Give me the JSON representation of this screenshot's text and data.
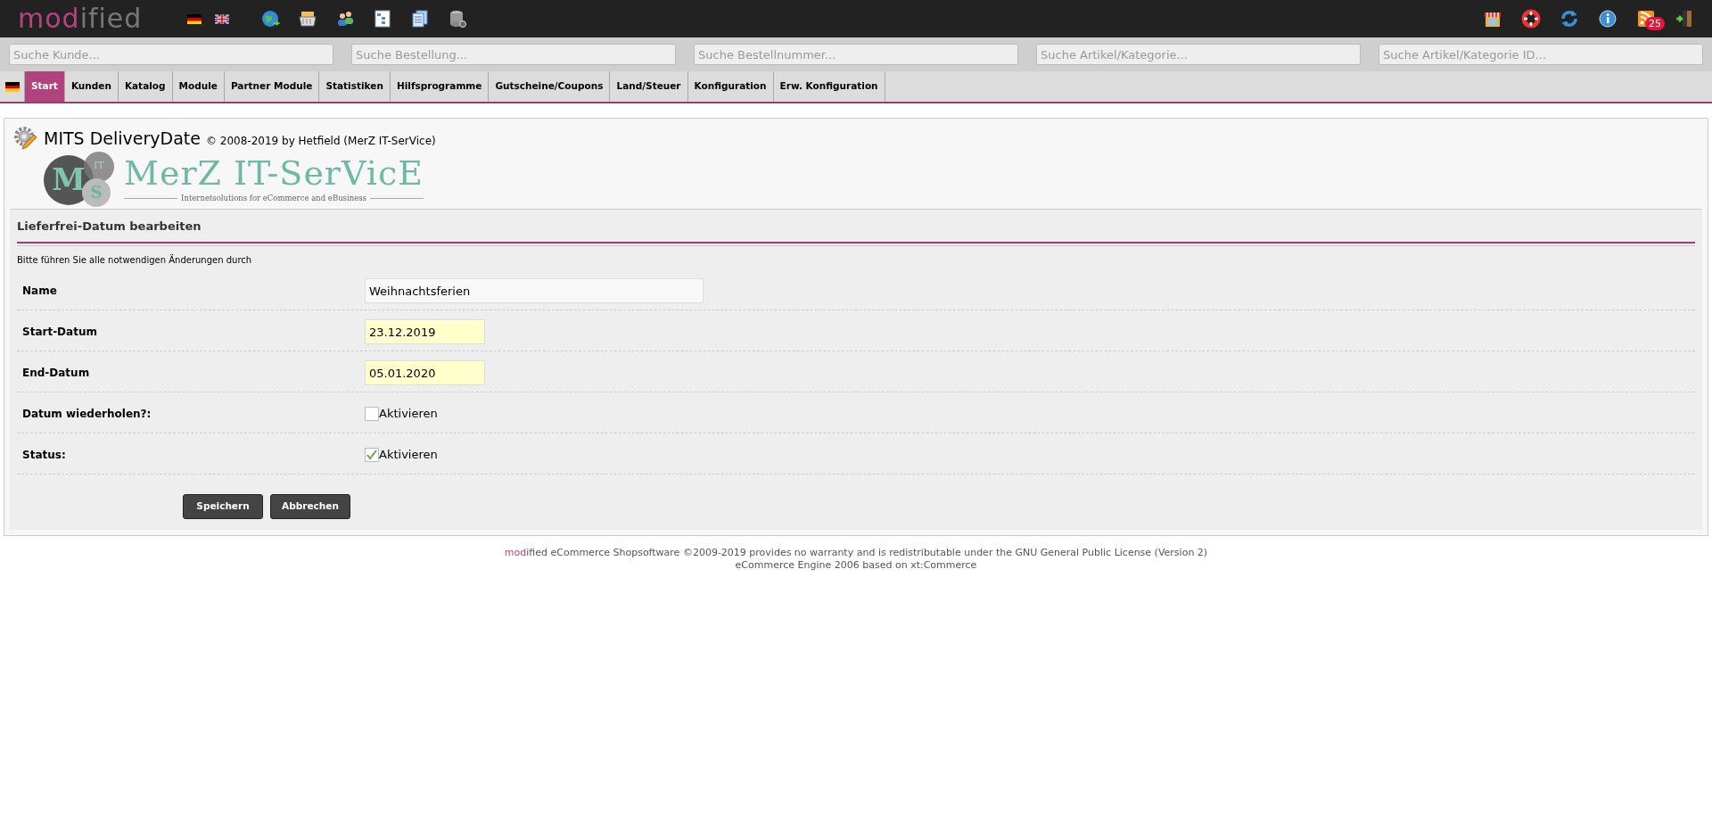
{
  "logo": {
    "accent": "mod",
    "rest": "ified"
  },
  "languages": [
    {
      "kind": "de"
    },
    {
      "kind": "en"
    }
  ],
  "toolbar_left": [
    {
      "kind": "globe"
    },
    {
      "kind": "basket"
    },
    {
      "kind": "users"
    },
    {
      "kind": "tree"
    },
    {
      "kind": "docs"
    },
    {
      "kind": "database"
    }
  ],
  "toolbar_right": [
    {
      "kind": "shop"
    },
    {
      "kind": "help"
    },
    {
      "kind": "refresh"
    },
    {
      "kind": "info"
    },
    {
      "kind": "rss",
      "badge": "25"
    },
    {
      "kind": "exit"
    }
  ],
  "searches": [
    {
      "placeholder": "Suche Kunde..."
    },
    {
      "placeholder": "Suche Bestellung..."
    },
    {
      "placeholder": "Suche Bestellnummer..."
    },
    {
      "placeholder": "Suche Artikel/Kategorie..."
    },
    {
      "placeholder": "Suche Artikel/Kategorie ID..."
    }
  ],
  "nav": [
    {
      "label": "Start",
      "selected": true
    },
    {
      "label": "Kunden",
      "selected": false
    },
    {
      "label": "Katalog",
      "selected": false
    },
    {
      "label": "Module",
      "selected": false
    },
    {
      "label": "Partner Module",
      "selected": false
    },
    {
      "label": "Statistiken",
      "selected": false
    },
    {
      "label": "Hilfsprogramme",
      "selected": false
    },
    {
      "label": "Gutscheine/Coupons",
      "selected": false
    },
    {
      "label": "Land/Steuer",
      "selected": false
    },
    {
      "label": "Konfiguration",
      "selected": false
    },
    {
      "label": "Erw. Konfiguration",
      "selected": false
    }
  ],
  "module": {
    "title": "MITS DeliveryDate",
    "copyright": "© 2008-2019 by Hetfield (MerZ IT-SerVice)",
    "banner": {
      "m": "M",
      "it": "IT",
      "s": "S",
      "name": "MerZ IT-SerVicE",
      "tagline": "Internetsolutions for eCommerce and eBusiness"
    }
  },
  "section_title": "Lieferfrei-Datum bearbeiten",
  "hint": "Bitte führen Sie alle notwendigen Änderungen durch",
  "fields": [
    {
      "kind": "text",
      "label": "Name",
      "value": "Weihnachtsferien"
    },
    {
      "kind": "date",
      "label": "Start-Datum",
      "value": "23.12.2019"
    },
    {
      "kind": "date",
      "label": "End-Datum",
      "value": "05.01.2020"
    },
    {
      "kind": "checkbox",
      "label": "Datum wiederholen?:",
      "option": "Aktivieren",
      "checked": false
    },
    {
      "kind": "checkbox",
      "label": "Status:",
      "option": "Aktivieren",
      "checked": true
    }
  ],
  "buttons": [
    "Speichern",
    "Abbrechen"
  ],
  "footer": {
    "accent": "mod",
    "line_1": "ified eCommerce Shopsoftware ©2009-2019 provides no warranty and is redistributable under the GNU General Public License (Version 2)",
    "line_2": "eCommerce Engine 2006 based on xt:Commerce"
  }
}
